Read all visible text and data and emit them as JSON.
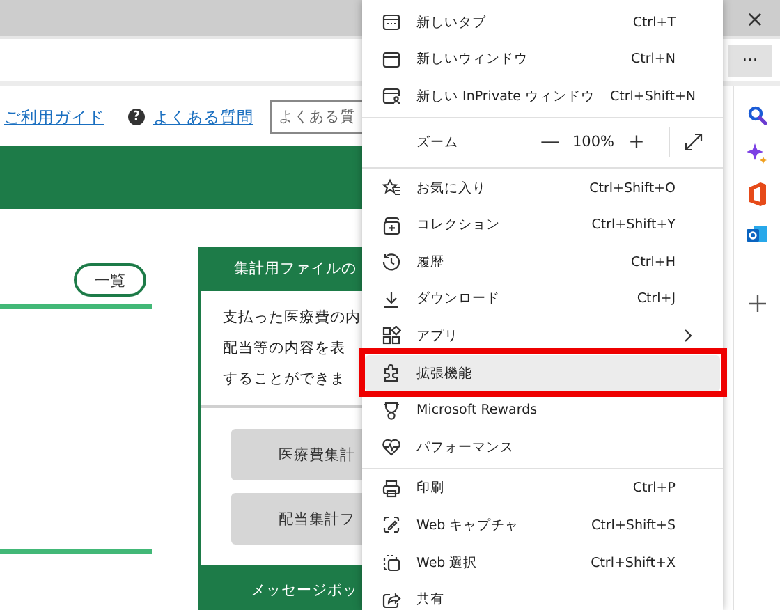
{
  "browser": {
    "close_button": "×",
    "more_button": "···"
  },
  "page": {
    "guide_link": "ご利用ガイド",
    "faq_link": {
      "badge": "?",
      "label": "よくある質問"
    },
    "search": {
      "placeholder": "よくある質"
    },
    "list_button": "一覧",
    "card": {
      "title": "集計用ファイルの",
      "body": [
        "支払った医療費の内",
        "配当等の内容を表",
        "することができま"
      ],
      "buttons": [
        "医療費集計",
        "配当集計フ"
      ],
      "footer": "メッセージボッ"
    }
  },
  "menu": {
    "sections": [
      {
        "kind": "items",
        "items": [
          {
            "label": "新しいタブ",
            "shortcut": "Ctrl+T",
            "highlighted": false
          },
          {
            "label": "新しいウィンドウ",
            "shortcut": "Ctrl+N",
            "highlighted": false
          },
          {
            "label": "新しい InPrivate ウィンドウ",
            "shortcut": "Ctrl+Shift+N",
            "highlighted": false
          }
        ]
      },
      {
        "kind": "zoom",
        "label": "ズーム",
        "decrease": "—",
        "value": "100%",
        "increase": "+"
      },
      {
        "kind": "items",
        "items": [
          {
            "label": "お気に入り",
            "shortcut": "Ctrl+Shift+O",
            "highlighted": false
          },
          {
            "label": "コレクション",
            "shortcut": "Ctrl+Shift+Y",
            "highlighted": false
          },
          {
            "label": "履歴",
            "shortcut": "Ctrl+H",
            "highlighted": false
          },
          {
            "label": "ダウンロード",
            "shortcut": "Ctrl+J",
            "highlighted": false
          },
          {
            "label": "アプリ",
            "submenu": true,
            "highlighted": false
          },
          {
            "label": "拡張機能",
            "highlighted": true
          },
          {
            "label": "Microsoft Rewards",
            "highlighted": false
          },
          {
            "label": "パフォーマンス",
            "highlighted": false
          }
        ]
      },
      {
        "kind": "items",
        "items": [
          {
            "label": "印刷",
            "shortcut": "Ctrl+P",
            "highlighted": false
          },
          {
            "label": "Web キャプチャ",
            "shortcut": "Ctrl+Shift+S",
            "highlighted": false
          },
          {
            "label": "Web 選択",
            "shortcut": "Ctrl+Shift+X",
            "highlighted": false
          },
          {
            "label": "共有",
            "highlighted": false
          }
        ]
      }
    ]
  }
}
